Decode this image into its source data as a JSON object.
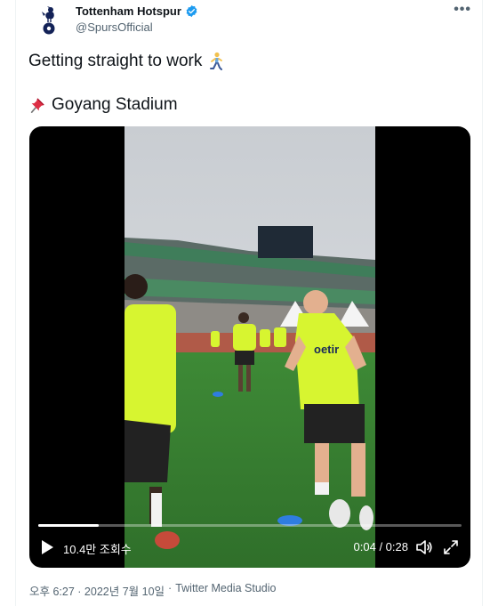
{
  "author": {
    "display_name": "Tottenham Hotspur",
    "handle": "@SpursOfficial",
    "verified": true
  },
  "more_label": "•••",
  "tweet": {
    "line1_text": "Getting straight to work",
    "line1_emoji": "running-person-icon",
    "line2_emoji": "pushpin-icon",
    "line2_text": "Goyang Stadium"
  },
  "video": {
    "views_label": "10.4만 조회수",
    "time_label": "0:04 / 0:28",
    "progress": 0.143
  },
  "meta": {
    "timestamp": "오후 6:27 · 2022년 7월 10일",
    "separator": "·",
    "source": "Twitter Media Studio"
  },
  "colors": {
    "verified_blue": "#1d9bf0",
    "secondary_text": "#536471",
    "kit_yellow": "#d7f530"
  }
}
